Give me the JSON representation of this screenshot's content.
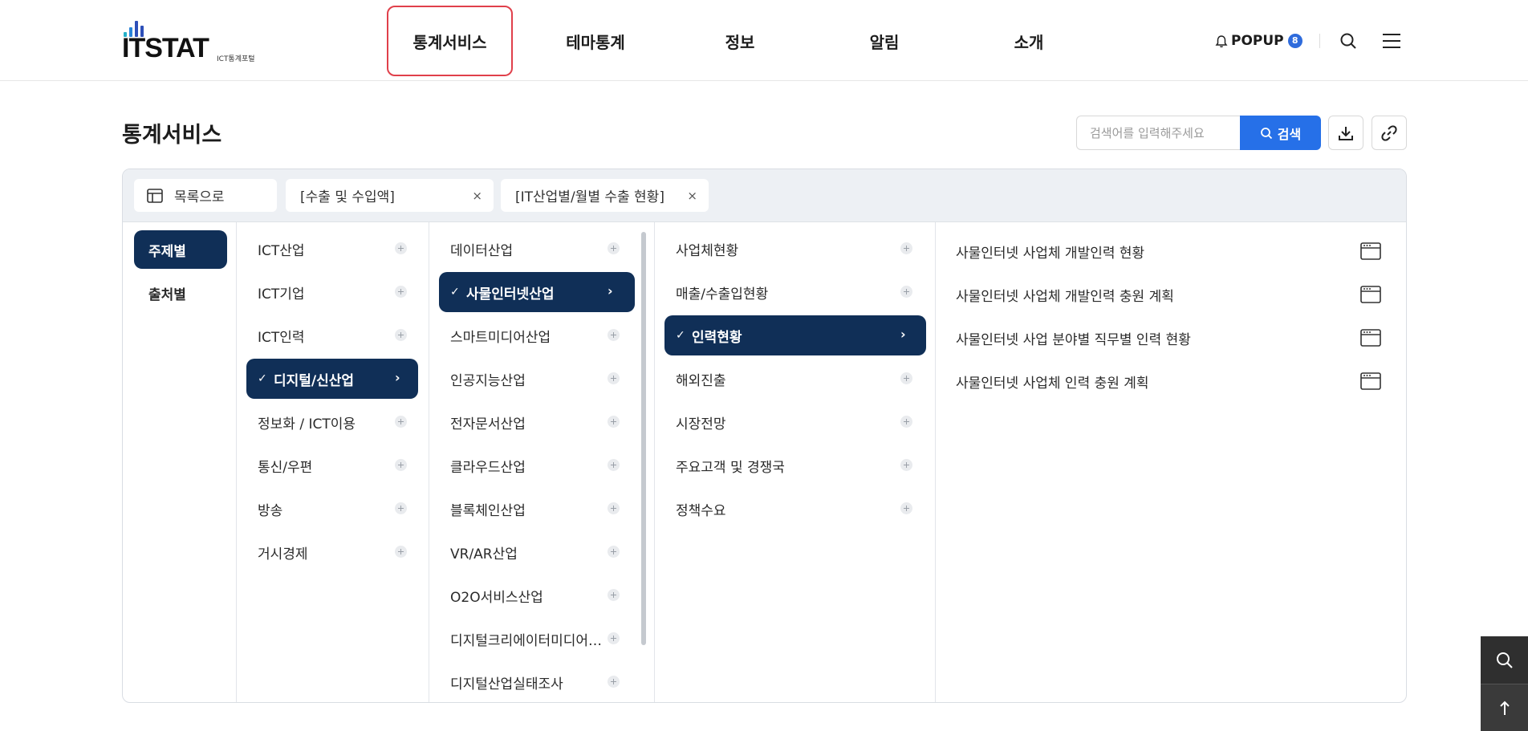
{
  "header": {
    "logo_text": "ITSTAT",
    "logo_sub": "ICT통계포털",
    "nav": [
      {
        "label": "통계서비스",
        "active": true
      },
      {
        "label": "테마통계"
      },
      {
        "label": "정보"
      },
      {
        "label": "알림"
      },
      {
        "label": "소개"
      }
    ],
    "popup_label": "POPUP",
    "popup_count": "8"
  },
  "page": {
    "title": "통계서비스",
    "search_placeholder": "검색어를 입력해주세요",
    "search_button": "검색"
  },
  "filters": {
    "back_label": "목록으로",
    "chips": [
      "[수출 및 수입액]",
      "[IT산업별/월별 수출 현황]"
    ],
    "remove_symbol": "×"
  },
  "side_tabs": [
    "주제별",
    "출처별"
  ],
  "col1": [
    "ICT산업",
    "ICT기업",
    "ICT인력",
    "디지털/신산업",
    "정보화 / ICT이용",
    "통신/우편",
    "방송",
    "거시경제"
  ],
  "col1_selected": 3,
  "col2": [
    "데이터산업",
    "사물인터넷산업",
    "스마트미디어산업",
    "인공지능산업",
    "전자문서산업",
    "클라우드산업",
    "블록체인산업",
    "VR/AR산업",
    "O2O서비스산업",
    "디지털크리에이터미디어…",
    "디지털산업실태조사"
  ],
  "col2_selected": 1,
  "col3": [
    "사업체현황",
    "매출/수출입현황",
    "인력현황",
    "해외진출",
    "시장전망",
    "주요고객 및 경쟁국",
    "정책수요"
  ],
  "col3_selected": 2,
  "results": [
    "사물인터넷 사업체 개발인력 현황",
    "사물인터넷 사업체 개발인력 충원 계획",
    "사물인터넷 사업 분야별 직무별 인력 현황",
    "사물인터넷 사업체 인력 충원 계획"
  ],
  "colors": {
    "navy": "#102f57",
    "blue": "#2670e8",
    "active_border": "#e0404b"
  }
}
